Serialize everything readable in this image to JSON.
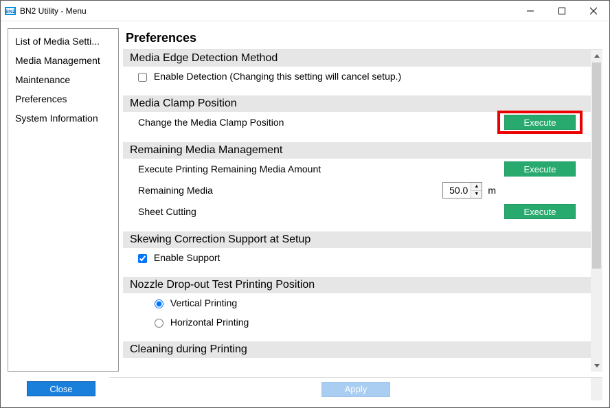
{
  "titlebar": {
    "title": "BN2 Utility - Menu"
  },
  "sidebar": {
    "items": [
      {
        "label": "List of Media Setti..."
      },
      {
        "label": "Media Management"
      },
      {
        "label": "Maintenance"
      },
      {
        "label": "Preferences"
      },
      {
        "label": "System Information"
      }
    ]
  },
  "main": {
    "pageTitle": "Preferences",
    "sections": {
      "edgeDetection": {
        "header": "Media Edge Detection Method",
        "checkboxLabel": "Enable Detection (Changing this setting will cancel setup.)"
      },
      "clampPosition": {
        "header": "Media Clamp Position",
        "label": "Change the Media Clamp Position",
        "button": "Execute"
      },
      "remainingMedia": {
        "header": "Remaining Media Management",
        "row1Label": "Execute Printing Remaining Media Amount",
        "row1Button": "Execute",
        "row2Label": "Remaining Media",
        "row2Value": "50.0",
        "row2Unit": "m",
        "row3Label": "Sheet Cutting",
        "row3Button": "Execute"
      },
      "skewing": {
        "header": "Skewing Correction Support at Setup",
        "checkboxLabel": "Enable Support"
      },
      "nozzle": {
        "header": "Nozzle Drop-out Test Printing Position",
        "option1": "Vertical Printing",
        "option2": "Horizontal Printing"
      },
      "cleaning": {
        "header": "Cleaning during Printing"
      }
    }
  },
  "footer": {
    "closeButton": "Close",
    "applyButton": "Apply"
  }
}
